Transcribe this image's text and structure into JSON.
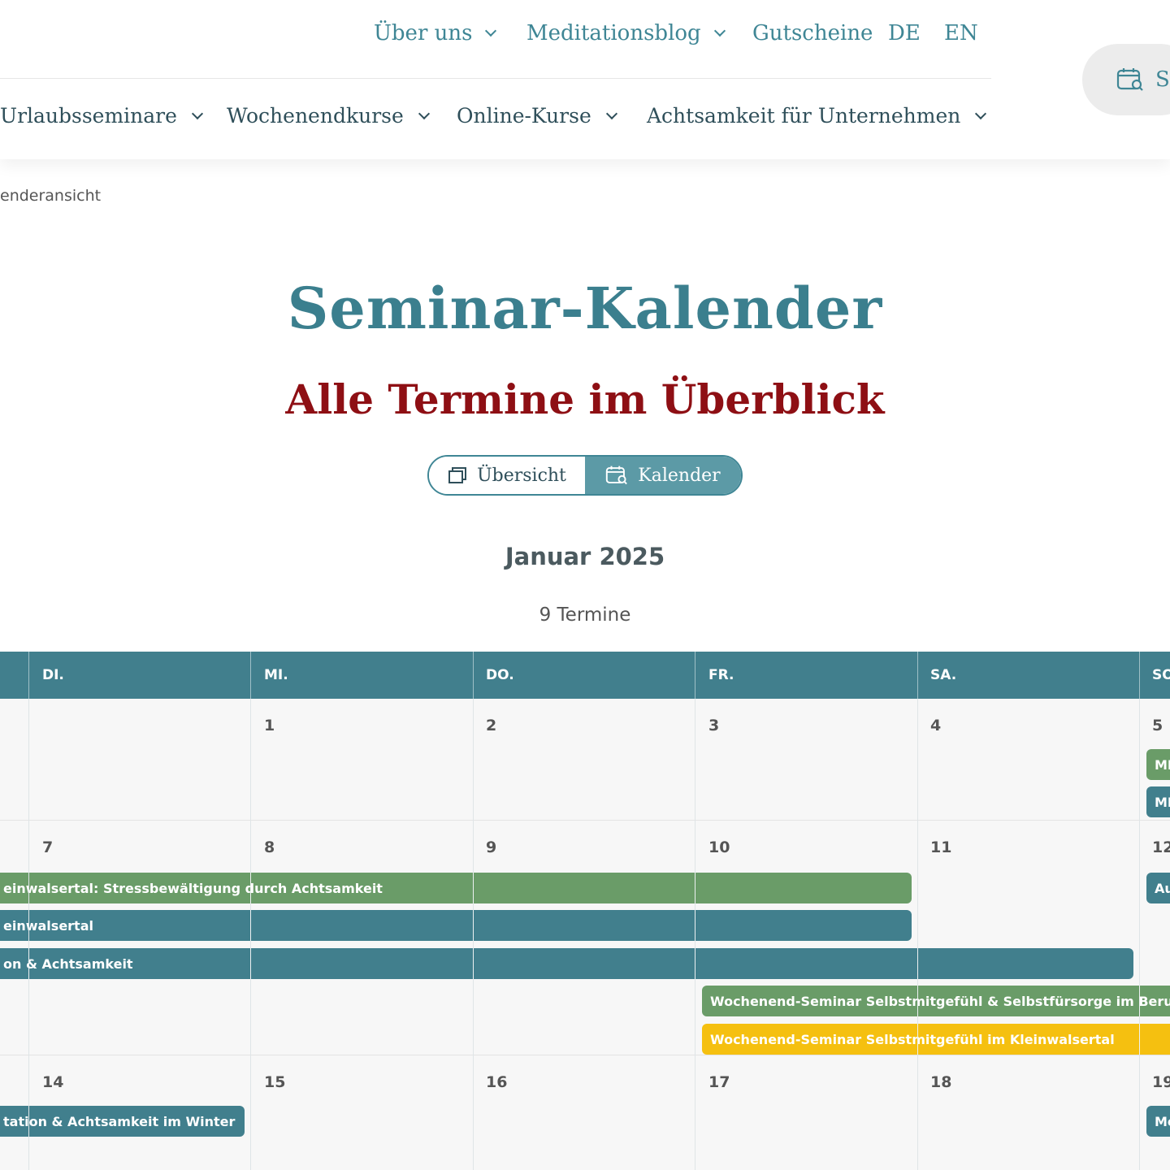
{
  "topnav": {
    "about": "Über uns",
    "blog": "Meditationsblog",
    "vouchers": "Gutscheine",
    "lang_de": "DE",
    "lang_en": "EN"
  },
  "mainnav": {
    "items": [
      "Urlaubsseminare",
      "Wochenendkurse",
      "Online-Kurse",
      "Achtsamkeit für Unternehmen"
    ]
  },
  "cta": {
    "label": "S"
  },
  "breadcrumb": "enderansicht",
  "page": {
    "title": "Seminar-Kalender",
    "subtitle": "Alle Termine im Überblick"
  },
  "view_toggle": {
    "overview": "Übersicht",
    "calendar": "Kalender",
    "active": "calendar"
  },
  "calendar": {
    "month": "Januar 2025",
    "event_count": "9 Termine",
    "day_headers": [
      "DI.",
      "MI.",
      "DO.",
      "FR.",
      "SA.",
      "SO"
    ],
    "weeks": [
      {
        "days": [
          "",
          "1",
          "2",
          "3",
          "4",
          "5"
        ]
      },
      {
        "days": [
          "7",
          "8",
          "9",
          "10",
          "11",
          "12"
        ]
      },
      {
        "days": [
          "14",
          "15",
          "16",
          "17",
          "18",
          "19"
        ]
      }
    ],
    "events": {
      "w1_a": "MI",
      "w1_b": "MI",
      "w2_a": "einwalsertal: Stressbewältigung durch Achtsamkeit",
      "w2_b": "einwalsertal",
      "w2_c": "on & Achtsamkeit",
      "w2_d": "Wochenend-Seminar Selbstmitgefühl & Selbstfürsorge im Beruf",
      "w2_e": "Wochenend-Seminar Selbstmitgefühl im Kleinwalsertal",
      "w2_f": "Au",
      "w3_a": "tation & Achtsamkeit im Winter",
      "w3_b": "Me"
    },
    "colors": {
      "green": "#6a9c68",
      "teal": "#417f8d",
      "yellow": "#f5c010"
    }
  }
}
